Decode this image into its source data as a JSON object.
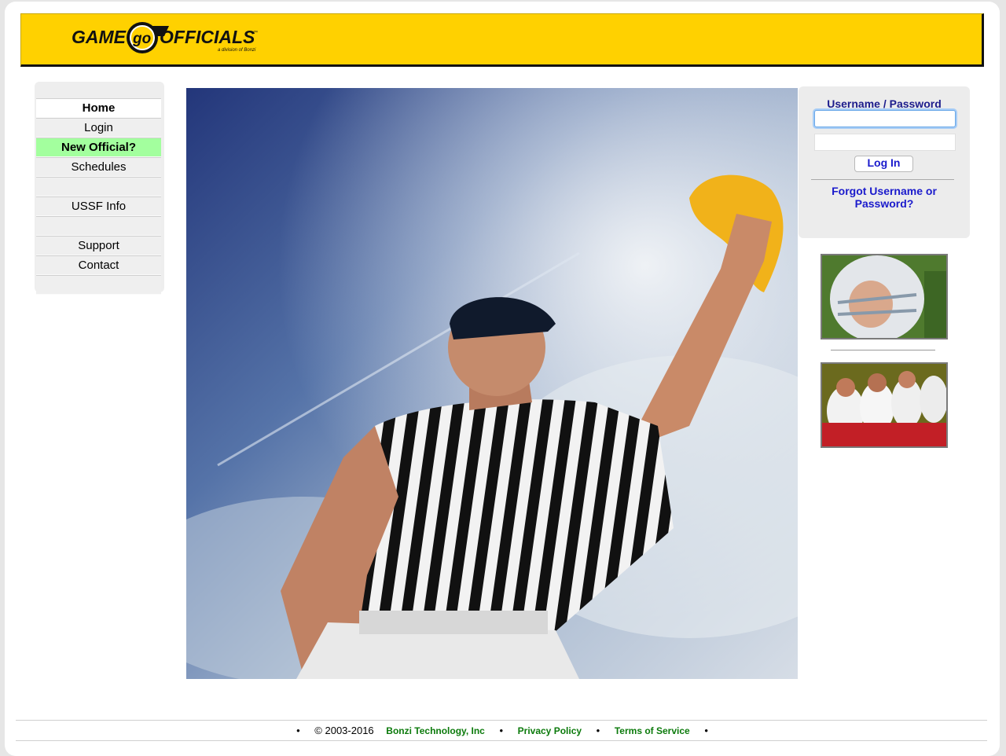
{
  "header": {
    "logo_text": "GAME go OFFICIALS",
    "logo_subtext": "a division of Bonzi",
    "brand_color": "#ffd100"
  },
  "nav": {
    "items": [
      {
        "label": "Home",
        "state": "active"
      },
      {
        "label": "Login",
        "state": "normal"
      },
      {
        "label": "New Official?",
        "state": "highlight"
      },
      {
        "label": "Schedules",
        "state": "normal"
      },
      {
        "label": "",
        "state": "blank"
      },
      {
        "label": "USSF Info",
        "state": "normal"
      },
      {
        "label": "",
        "state": "blank"
      },
      {
        "label": "Support",
        "state": "normal"
      },
      {
        "label": "Contact",
        "state": "normal"
      },
      {
        "label": "",
        "state": "blank"
      }
    ]
  },
  "hero": {
    "image": "referee-throwing-flag-photo"
  },
  "login": {
    "label": "Username / Password",
    "username_value": "",
    "password_value": "",
    "button_label": "Log In",
    "forgot_label": "Forgot Username or Password?"
  },
  "thumbs": [
    {
      "image": "youth-football-player-helmet-photo"
    },
    {
      "image": "football-team-bench-photo"
    }
  ],
  "footer": {
    "copyright": "© 2003-2016",
    "company_link": "Bonzi Technology, Inc",
    "privacy_link": "Privacy Policy",
    "terms_link": "Terms of Service",
    "link_color": "#0b7a0b"
  }
}
